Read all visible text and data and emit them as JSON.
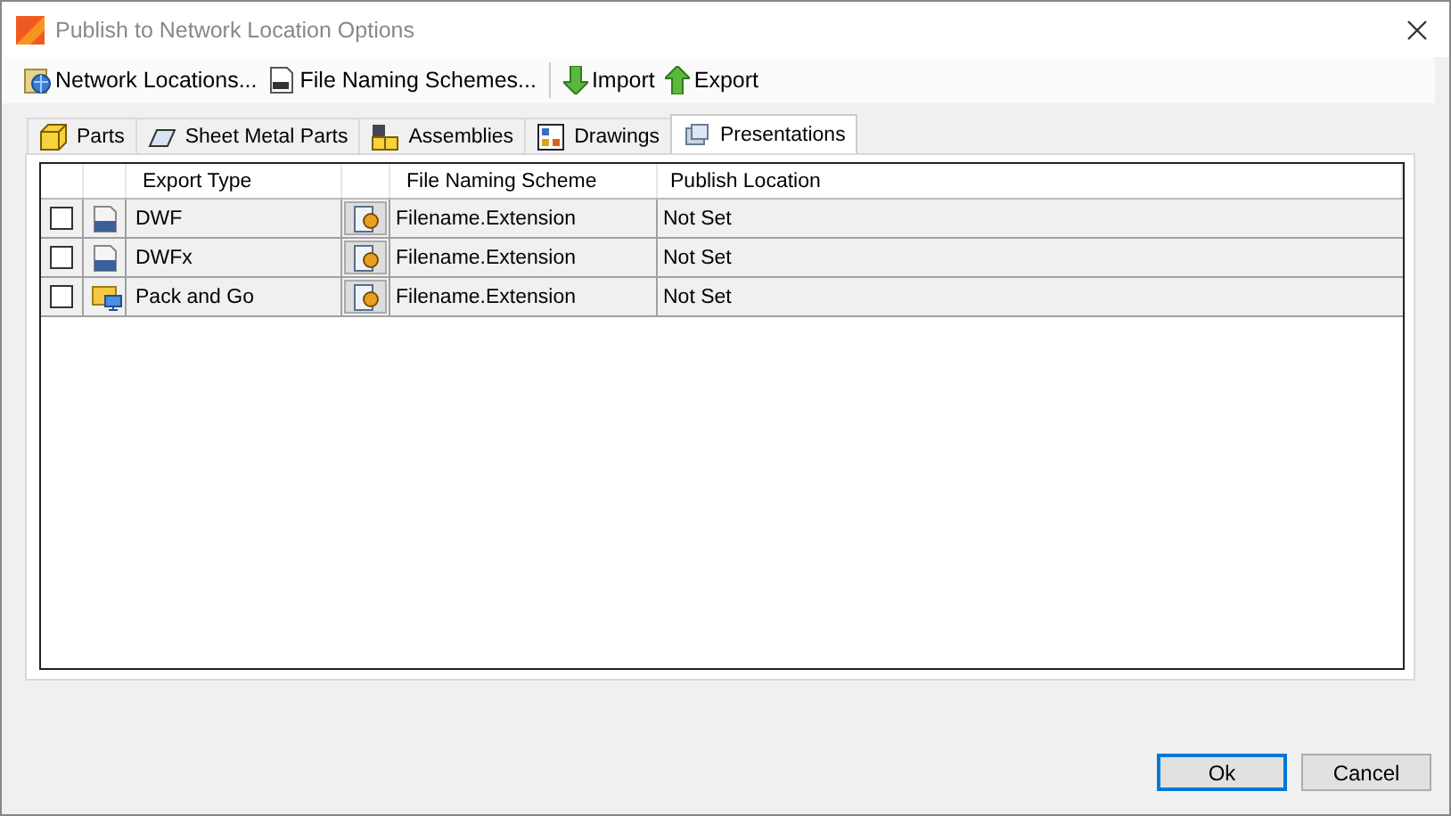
{
  "window": {
    "title": "Publish to Network Location Options"
  },
  "toolbar": [
    {
      "label": "Network Locations...",
      "kind": "network"
    },
    {
      "label": "File Naming Schemes...",
      "kind": "naming"
    },
    {
      "label": "Import",
      "kind": "import"
    },
    {
      "label": "Export",
      "kind": "export"
    }
  ],
  "tabs": [
    {
      "label": "Parts",
      "kind": "part",
      "selected": false
    },
    {
      "label": "Sheet Metal Parts",
      "kind": "sheet",
      "selected": false
    },
    {
      "label": "Assemblies",
      "kind": "assembly",
      "selected": false
    },
    {
      "label": "Drawings",
      "kind": "drawing",
      "selected": false
    },
    {
      "label": "Presentations",
      "kind": "presentation",
      "selected": true
    }
  ],
  "table": {
    "columns": [
      "Export Type",
      "File Naming Scheme",
      "Publish Location"
    ],
    "rows": [
      {
        "checked": false,
        "kind": "dwf",
        "export_type": "DWF",
        "naming": "Filename.Extension",
        "location": "Not  Set"
      },
      {
        "checked": false,
        "kind": "dwf",
        "export_type": "DWFx",
        "naming": "Filename.Extension",
        "location": "Not  Set"
      },
      {
        "checked": false,
        "kind": "pack",
        "export_type": "Pack and Go",
        "naming": "Filename.Extension",
        "location": "Not  Set"
      }
    ]
  },
  "buttons": [
    {
      "label": "Ok",
      "default": true
    },
    {
      "label": "Cancel",
      "default": false
    }
  ]
}
